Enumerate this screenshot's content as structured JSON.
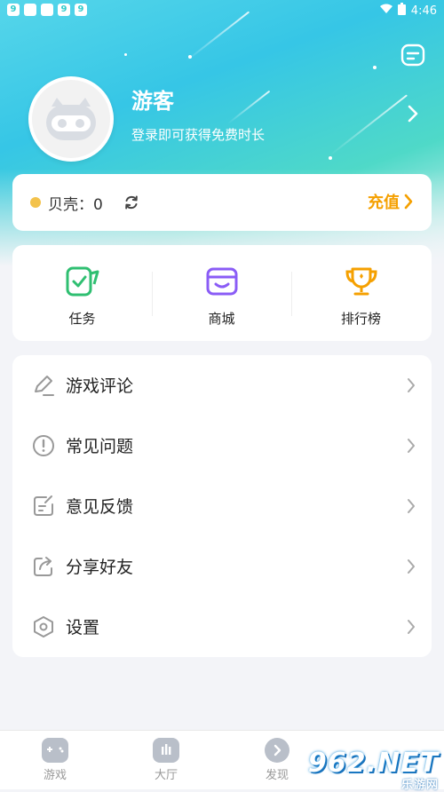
{
  "status_bar": {
    "time": "4:46"
  },
  "profile": {
    "name": "游客",
    "subtitle": "登录即可获得免费时长"
  },
  "shells": {
    "label": "贝壳：0",
    "recharge_label": "充值"
  },
  "quick_actions": [
    {
      "label": "任务",
      "icon": "task-icon",
      "color": "#2fbf71"
    },
    {
      "label": "商城",
      "icon": "store-icon",
      "color": "#8a5cf6"
    },
    {
      "label": "排行榜",
      "icon": "trophy-icon",
      "color": "#f5a000"
    }
  ],
  "menu": [
    {
      "label": "游戏评论",
      "icon": "pencil-icon"
    },
    {
      "label": "常见问题",
      "icon": "exclamation-circle-icon"
    },
    {
      "label": "意见反馈",
      "icon": "feedback-icon"
    },
    {
      "label": "分享好友",
      "icon": "share-icon"
    },
    {
      "label": "设置",
      "icon": "settings-hexagon-icon"
    }
  ],
  "tabs": [
    {
      "label": "游戏",
      "icon": "gamepad-icon"
    },
    {
      "label": "大厅",
      "icon": "hall-icon"
    },
    {
      "label": "发现",
      "icon": "discover-icon"
    }
  ],
  "watermark": {
    "brand": "962.NET",
    "site": "乐游网"
  },
  "colors": {
    "accent": "#f5a000",
    "hero": "#36c6e6"
  }
}
